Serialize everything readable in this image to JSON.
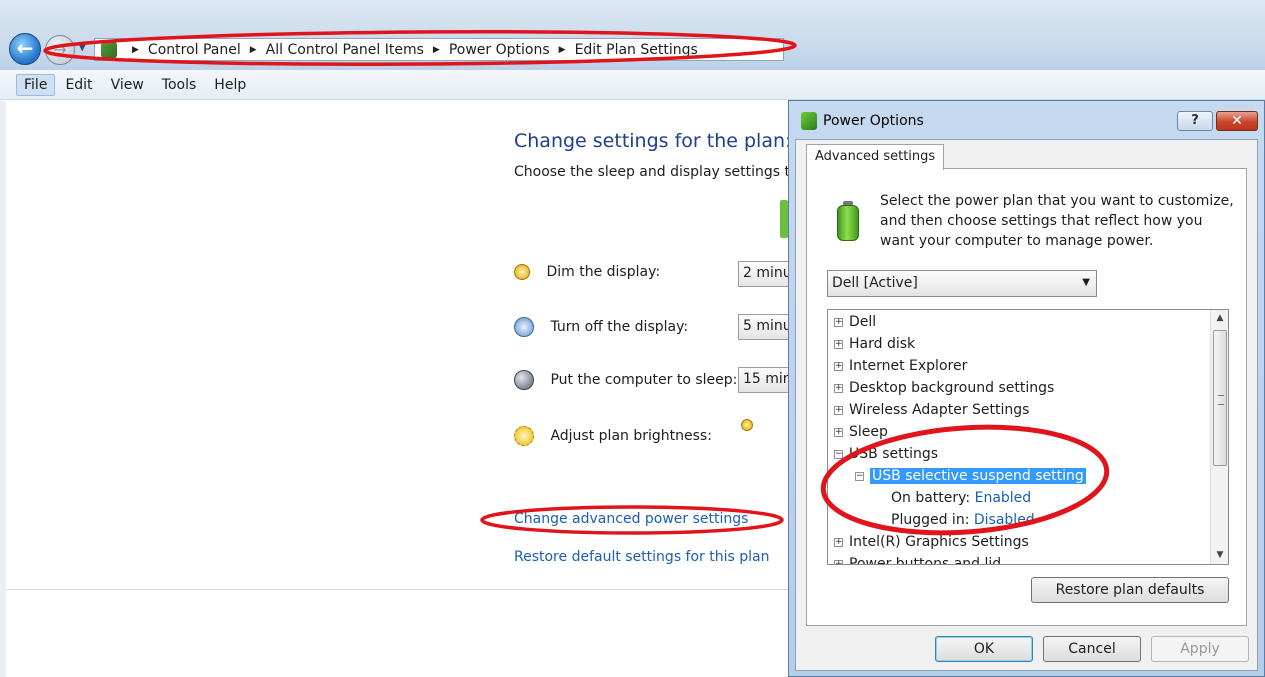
{
  "explorer": {
    "breadcrumbs": [
      "Control Panel",
      "All Control Panel Items",
      "Power Options",
      "Edit Plan Settings"
    ],
    "menu": [
      "File",
      "Edit",
      "View",
      "Tools",
      "Help"
    ]
  },
  "plan": {
    "title": "Change settings for the plan: De",
    "subtitle": "Choose the sleep and display settings tha",
    "rows": [
      {
        "label": "Dim the display:",
        "value": "2 minu"
      },
      {
        "label": "Turn off the display:",
        "value": "5 minu"
      },
      {
        "label": "Put the computer to sleep:",
        "value": "15 min"
      },
      {
        "label": "Adjust plan brightness:"
      }
    ],
    "link_advanced": "Change advanced power settings",
    "link_restore": "Restore default settings for this plan"
  },
  "dialog": {
    "title": "Power Options",
    "help_label": "?",
    "close_label": "✕",
    "tab": "Advanced settings",
    "intro": "Select the power plan that you want to customize, and then choose settings that reflect how you want your computer to manage power.",
    "plan_select": "Dell [Active]",
    "tree": [
      {
        "label": "Dell",
        "expander": "+"
      },
      {
        "label": "Hard disk",
        "expander": "+"
      },
      {
        "label": "Internet Explorer",
        "expander": "+"
      },
      {
        "label": "Desktop background settings",
        "expander": "+"
      },
      {
        "label": "Wireless Adapter Settings",
        "expander": "+"
      },
      {
        "label": "Sleep",
        "expander": "+"
      },
      {
        "label": "USB settings",
        "expander": "−"
      },
      {
        "label": "USB selective suspend setting",
        "expander": "−"
      },
      {
        "label": "On battery:",
        "value": "Enabled"
      },
      {
        "label": "Plugged in:",
        "value": "Disabled"
      },
      {
        "label": "Intel(R) Graphics Settings",
        "expander": "+"
      },
      {
        "label": "Power buttons and lid",
        "expander": "+"
      }
    ],
    "restore_button": "Restore plan defaults",
    "ok_button": "OK",
    "cancel_button": "Cancel",
    "apply_button": "Apply"
  },
  "colors": {
    "annotation": "#e0141a",
    "link": "#1a5fb4",
    "selection": "#3399ff"
  }
}
